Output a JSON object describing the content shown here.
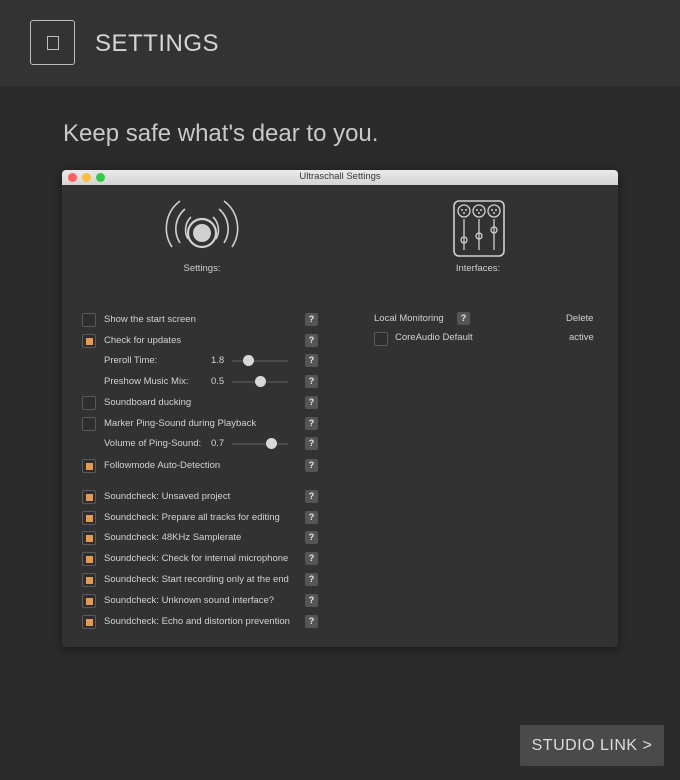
{
  "header": {
    "title": "SETTINGS",
    "icon": "page-icon"
  },
  "tagline": "Keep safe what's dear to you.",
  "window": {
    "title": "Ultraschall Settings",
    "settings_label": "Settings:",
    "interfaces_label": "Interfaces:"
  },
  "settings": {
    "show_start_screen": {
      "label": "Show the start screen",
      "checked": false
    },
    "check_updates": {
      "label": "Check for updates",
      "checked": true
    },
    "preroll": {
      "label": "Preroll Time:",
      "value": "1.8",
      "level": 0.3
    },
    "preshow": {
      "label": "Preshow Music Mix:",
      "value": "0.5",
      "level": 0.5
    },
    "soundboard_ducking": {
      "label": "Soundboard ducking",
      "checked": false
    },
    "marker_ping": {
      "label": "Marker Ping-Sound during Playback",
      "checked": false
    },
    "ping_volume": {
      "label": "Volume of Ping-Sound:",
      "value": "0.7",
      "level": 0.7
    },
    "followmode": {
      "label": "Followmode Auto-Detection",
      "checked": true
    },
    "sc_unsaved": {
      "label": "Soundcheck: Unsaved project",
      "checked": true
    },
    "sc_prepare": {
      "label": "Soundcheck: Prepare all tracks for editing",
      "checked": true
    },
    "sc_samplerate": {
      "label": "Soundcheck: 48KHz Samplerate",
      "checked": true
    },
    "sc_microphone": {
      "label": "Soundcheck: Check for internal microphone",
      "checked": true
    },
    "sc_recording": {
      "label": "Soundcheck: Start recording only at the end",
      "checked": true
    },
    "sc_interface": {
      "label": "Soundcheck: Unknown sound interface?",
      "checked": true
    },
    "sc_echo": {
      "label": "Soundcheck: Echo and distortion prevention",
      "checked": true
    },
    "help_glyph": "?"
  },
  "interfaces": {
    "local_monitoring": "Local Monitoring",
    "delete": "Delete",
    "device": {
      "label": "CoreAudio Default",
      "status": "active",
      "checked": false
    }
  },
  "footer": {
    "studio_link": "STUDIO LINK >"
  },
  "colors": {
    "accent": "#e09a5a",
    "background": "#2b2b2b",
    "header": "#333333",
    "window": "#323232"
  }
}
